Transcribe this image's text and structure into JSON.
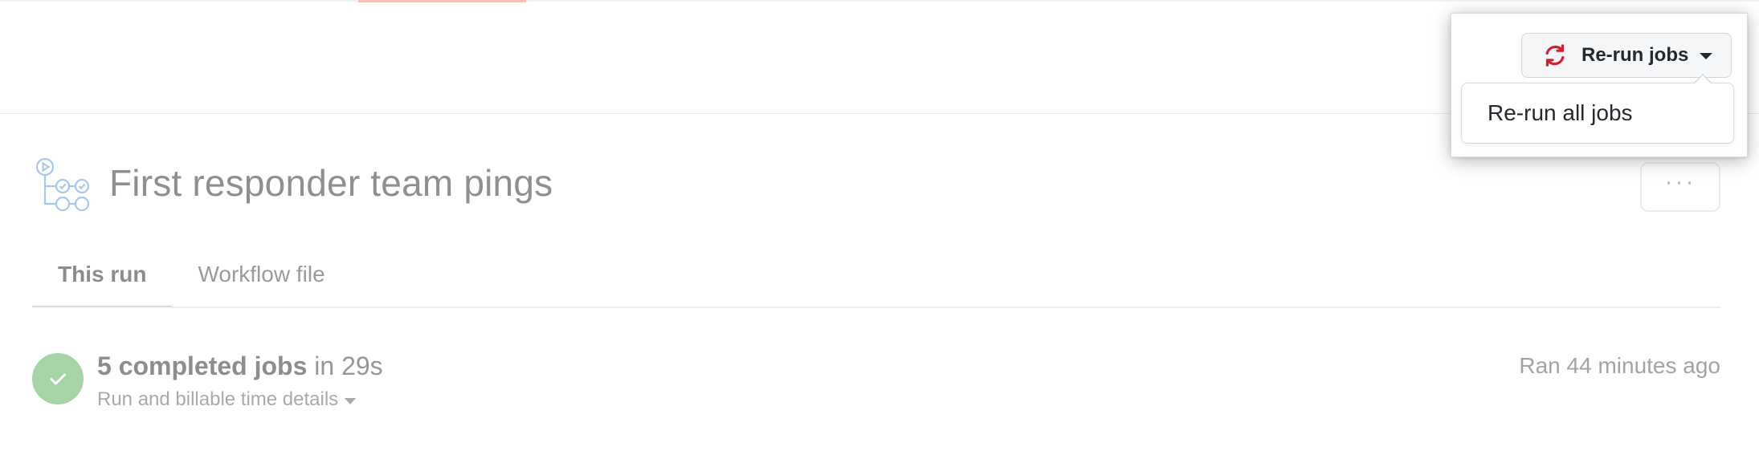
{
  "header": {
    "title": "First responder team pings",
    "more_button_label": "···"
  },
  "tabs": [
    {
      "label": "This run",
      "active": true
    },
    {
      "label": "Workflow file",
      "active": false
    }
  ],
  "run_summary": {
    "jobs_count_text": "5 completed jobs",
    "duration_text": "in 29s",
    "details_link": "Run and billable time details",
    "ran_ago": "Ran 44 minutes ago",
    "status": "success"
  },
  "rerun_dropdown": {
    "button_label": "Re-run jobs",
    "menu_items": [
      "Re-run all jobs"
    ]
  },
  "icons": {
    "workflow": "workflow-icon",
    "success": "check-circle-icon",
    "rerun": "sync-icon",
    "caret": "triangle-down-icon",
    "more": "kebab-horizontal-icon"
  },
  "colors": {
    "rerun_icon": "#cf222e",
    "success_badge": "#a6d4a6",
    "tab_underline": "#f6b6a7",
    "workflow_icon": "#a9c7ea"
  }
}
